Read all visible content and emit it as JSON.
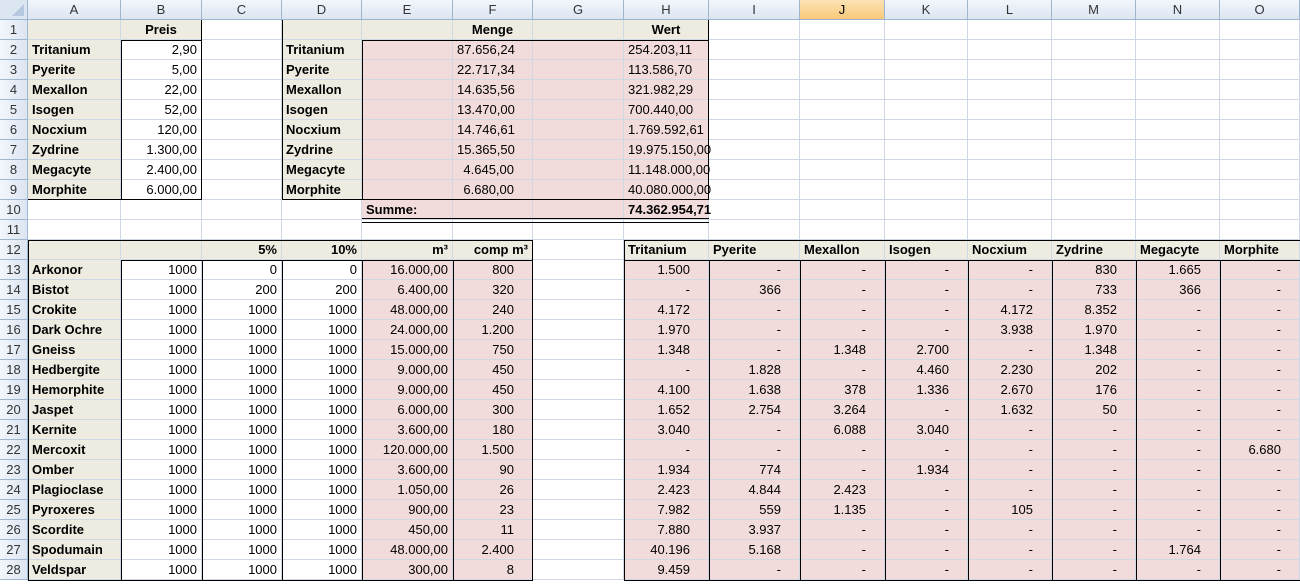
{
  "columns": [
    "A",
    "B",
    "C",
    "D",
    "E",
    "F",
    "G",
    "H",
    "I",
    "J",
    "K",
    "L",
    "M",
    "N",
    "O"
  ],
  "selected_column": "J",
  "rows": [
    "1",
    "2",
    "3",
    "4",
    "5",
    "6",
    "7",
    "8",
    "9",
    "10",
    "11",
    "12",
    "13",
    "14",
    "15",
    "16",
    "17",
    "18",
    "19",
    "20",
    "21",
    "22",
    "23",
    "24",
    "25",
    "26",
    "27",
    "28"
  ],
  "prices": {
    "header": "Preis",
    "items": [
      {
        "name": "Tritanium",
        "price": "2,90"
      },
      {
        "name": "Pyerite",
        "price": "5,00"
      },
      {
        "name": "Mexallon",
        "price": "22,00"
      },
      {
        "name": "Isogen",
        "price": "52,00"
      },
      {
        "name": "Nocxium",
        "price": "120,00"
      },
      {
        "name": "Zydrine",
        "price": "1.300,00"
      },
      {
        "name": "Megacyte",
        "price": "2.400,00"
      },
      {
        "name": "Morphite",
        "price": "6.000,00"
      }
    ]
  },
  "summary": {
    "menge_header": "Menge",
    "wert_header": "Wert",
    "items": [
      {
        "name": "Tritanium",
        "menge": "87.656,24",
        "wert": "254.203,11"
      },
      {
        "name": "Pyerite",
        "menge": "22.717,34",
        "wert": "113.586,70"
      },
      {
        "name": "Mexallon",
        "menge": "14.635,56",
        "wert": "321.982,29"
      },
      {
        "name": "Isogen",
        "menge": "13.470,00",
        "wert": "700.440,00"
      },
      {
        "name": "Nocxium",
        "menge": "14.746,61",
        "wert": "1.769.592,61"
      },
      {
        "name": "Zydrine",
        "menge": "15.365,50",
        "wert": "19.975.150,00"
      },
      {
        "name": "Megacyte",
        "menge": "4.645,00",
        "wert": "11.148.000,00"
      },
      {
        "name": "Morphite",
        "menge": "6.680,00",
        "wert": "40.080.000,00"
      }
    ],
    "sum_label": "Summe:",
    "sum_value": "74.362.954,71"
  },
  "ores": {
    "headers": {
      "c": "5%",
      "d": "10%",
      "e": "m³",
      "f": "comp m³"
    },
    "items": [
      {
        "name": "Arkonor",
        "b": "1000",
        "c": "0",
        "d": "0",
        "e": "16.000,00",
        "f": "800"
      },
      {
        "name": "Bistot",
        "b": "1000",
        "c": "200",
        "d": "200",
        "e": "6.400,00",
        "f": "320"
      },
      {
        "name": "Crokite",
        "b": "1000",
        "c": "1000",
        "d": "1000",
        "e": "48.000,00",
        "f": "240"
      },
      {
        "name": "Dark Ochre",
        "b": "1000",
        "c": "1000",
        "d": "1000",
        "e": "24.000,00",
        "f": "1.200"
      },
      {
        "name": "Gneiss",
        "b": "1000",
        "c": "1000",
        "d": "1000",
        "e": "15.000,00",
        "f": "750"
      },
      {
        "name": "Hedbergite",
        "b": "1000",
        "c": "1000",
        "d": "1000",
        "e": "9.000,00",
        "f": "450"
      },
      {
        "name": "Hemorphite",
        "b": "1000",
        "c": "1000",
        "d": "1000",
        "e": "9.000,00",
        "f": "450"
      },
      {
        "name": "Jaspet",
        "b": "1000",
        "c": "1000",
        "d": "1000",
        "e": "6.000,00",
        "f": "300"
      },
      {
        "name": "Kernite",
        "b": "1000",
        "c": "1000",
        "d": "1000",
        "e": "3.600,00",
        "f": "180"
      },
      {
        "name": "Mercoxit",
        "b": "1000",
        "c": "1000",
        "d": "1000",
        "e": "120.000,00",
        "f": "1.500"
      },
      {
        "name": "Omber",
        "b": "1000",
        "c": "1000",
        "d": "1000",
        "e": "3.600,00",
        "f": "90"
      },
      {
        "name": "Plagioclase",
        "b": "1000",
        "c": "1000",
        "d": "1000",
        "e": "1.050,00",
        "f": "26"
      },
      {
        "name": "Pyroxeres",
        "b": "1000",
        "c": "1000",
        "d": "1000",
        "e": "900,00",
        "f": "23"
      },
      {
        "name": "Scordite",
        "b": "1000",
        "c": "1000",
        "d": "1000",
        "e": "450,00",
        "f": "11"
      },
      {
        "name": "Spodumain",
        "b": "1000",
        "c": "1000",
        "d": "1000",
        "e": "48.000,00",
        "f": "2.400"
      },
      {
        "name": "Veldspar",
        "b": "1000",
        "c": "1000",
        "d": "1000",
        "e": "300,00",
        "f": "8"
      }
    ]
  },
  "refine": {
    "headers": [
      "Tritanium",
      "Pyerite",
      "Mexallon",
      "Isogen",
      "Nocxium",
      "Zydrine",
      "Megacyte",
      "Morphite"
    ],
    "rows": [
      [
        "1.500",
        "-",
        "-",
        "-",
        "-",
        "830",
        "1.665",
        "-"
      ],
      [
        "-",
        "366",
        "-",
        "-",
        "-",
        "733",
        "366",
        "-"
      ],
      [
        "4.172",
        "-",
        "-",
        "-",
        "4.172",
        "8.352",
        "-",
        "-"
      ],
      [
        "1.970",
        "-",
        "-",
        "-",
        "3.938",
        "1.970",
        "-",
        "-"
      ],
      [
        "1.348",
        "-",
        "1.348",
        "2.700",
        "-",
        "1.348",
        "-",
        "-"
      ],
      [
        "-",
        "1.828",
        "-",
        "4.460",
        "2.230",
        "202",
        "-",
        "-"
      ],
      [
        "4.100",
        "1.638",
        "378",
        "1.336",
        "2.670",
        "176",
        "-",
        "-"
      ],
      [
        "1.652",
        "2.754",
        "3.264",
        "-",
        "1.632",
        "50",
        "-",
        "-"
      ],
      [
        "3.040",
        "-",
        "6.088",
        "3.040",
        "-",
        "-",
        "-",
        "-"
      ],
      [
        "-",
        "-",
        "-",
        "-",
        "-",
        "-",
        "-",
        "6.680"
      ],
      [
        "1.934",
        "774",
        "-",
        "1.934",
        "-",
        "-",
        "-",
        "-"
      ],
      [
        "2.423",
        "4.844",
        "2.423",
        "-",
        "-",
        "-",
        "-",
        "-"
      ],
      [
        "7.982",
        "559",
        "1.135",
        "-",
        "105",
        "-",
        "-",
        "-"
      ],
      [
        "7.880",
        "3.937",
        "-",
        "-",
        "-",
        "-",
        "-",
        "-"
      ],
      [
        "40.196",
        "5.168",
        "-",
        "-",
        "-",
        "-",
        "1.764",
        "-"
      ],
      [
        "9.459",
        "-",
        "-",
        "-",
        "-",
        "-",
        "-",
        "-"
      ]
    ]
  }
}
